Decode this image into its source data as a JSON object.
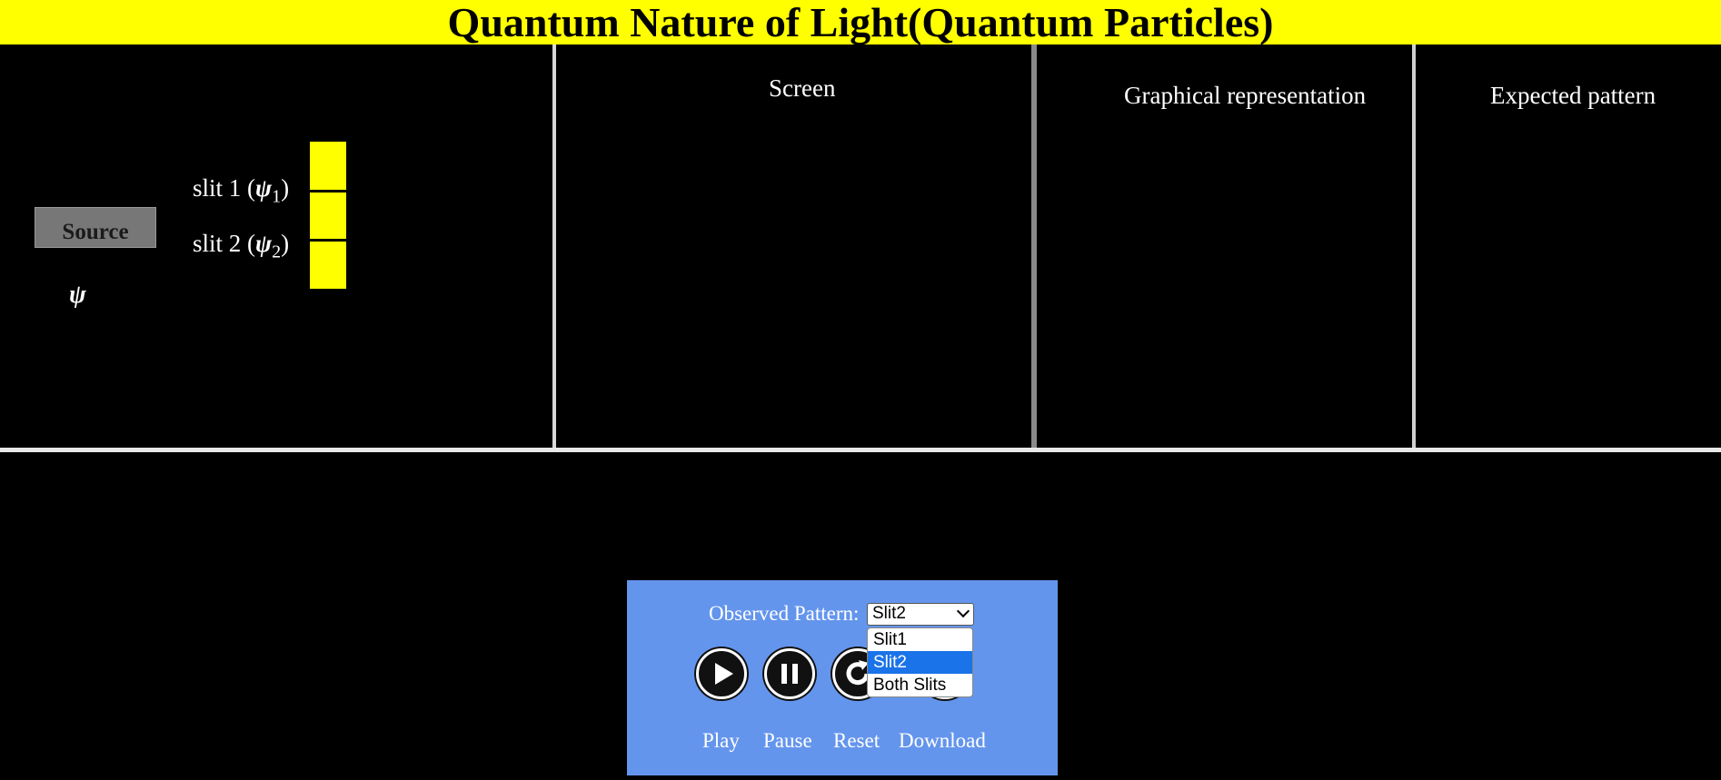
{
  "title": "Quantum Nature of Light(Quantum Particles)",
  "colors": {
    "title_bg": "#ffff00",
    "background": "#000000",
    "barrier": "#ffff00",
    "control_panel": "#6495ed",
    "selected_option": "#1a73e8"
  },
  "apparatus": {
    "source_label": "Source",
    "psi": "ψ",
    "slit1": {
      "prefix": "slit 1 (",
      "psi": "ψ",
      "sub": "1",
      "suffix": ")"
    },
    "slit2": {
      "prefix": "slit 2 (",
      "psi": "ψ",
      "sub": "2",
      "suffix": ")"
    }
  },
  "panels": {
    "screen": "Screen",
    "graph": "Graphical representation",
    "expected": "Expected pattern"
  },
  "controls": {
    "observed_label": "Observed Pattern:",
    "selected_value": "Slit2",
    "options": [
      "Slit1",
      "Slit2",
      "Both Slits"
    ],
    "buttons": {
      "play": "Play",
      "pause": "Pause",
      "reset": "Reset",
      "download": "Download"
    }
  },
  "icons": {
    "play": "play-icon",
    "pause": "pause-icon",
    "reset": "reset-icon",
    "download": "download-icon"
  }
}
